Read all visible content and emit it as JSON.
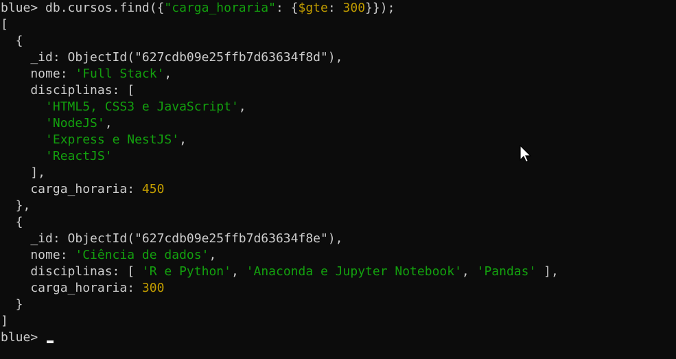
{
  "prompt": "blue> ",
  "command": {
    "prefix": "db.cursos.find({",
    "key_str": "\"carga_horaria\"",
    "colon": ": {",
    "op": "$gte",
    "colon2": ": ",
    "value": "300",
    "suffix": "}});"
  },
  "output": {
    "open_bracket": "[",
    "close_bracket": "]",
    "doc1": {
      "open": "  {",
      "id_line": "    _id: ObjectId(\"627cdb09e25ffb7d63634f8d\"),",
      "nome_key": "    nome: ",
      "nome_val": "'Full Stack'",
      "nome_end": ",",
      "disc_open": "    disciplinas: [",
      "disc_items": [
        {
          "indent": "      ",
          "val": "'HTML5, CSS3 e JavaScript'",
          "end": ","
        },
        {
          "indent": "      ",
          "val": "'NodeJS'",
          "end": ","
        },
        {
          "indent": "      ",
          "val": "'Express e NestJS'",
          "end": ","
        },
        {
          "indent": "      ",
          "val": "'ReactJS'",
          "end": ""
        }
      ],
      "disc_close": "    ],",
      "carga_key": "    carga_horaria: ",
      "carga_val": "450",
      "close": "  },"
    },
    "doc2": {
      "open": "  {",
      "id_line": "    _id: ObjectId(\"627cdb09e25ffb7d63634f8e\"),",
      "nome_key": "    nome: ",
      "nome_val": "'Ciência de dados'",
      "nome_end": ",",
      "disc_key": "    disciplinas: [ ",
      "disc_v1": "'R e Python'",
      "sep1": ", ",
      "disc_v2": "'Anaconda e Jupyter Notebook'",
      "sep2": ", ",
      "disc_v3": "'Pandas'",
      "disc_end": " ],",
      "carga_key": "    carga_horaria: ",
      "carga_val": "300",
      "close": "  }"
    }
  },
  "final_prompt": "blue> ",
  "colors": {
    "background": "#0c0c0c",
    "text": "#cccccc",
    "string": "#13a10e",
    "number": "#c19c00"
  },
  "icons": {
    "mouse_pointer": "arrow-cursor-icon",
    "text_cursor": "block-cursor-icon"
  }
}
